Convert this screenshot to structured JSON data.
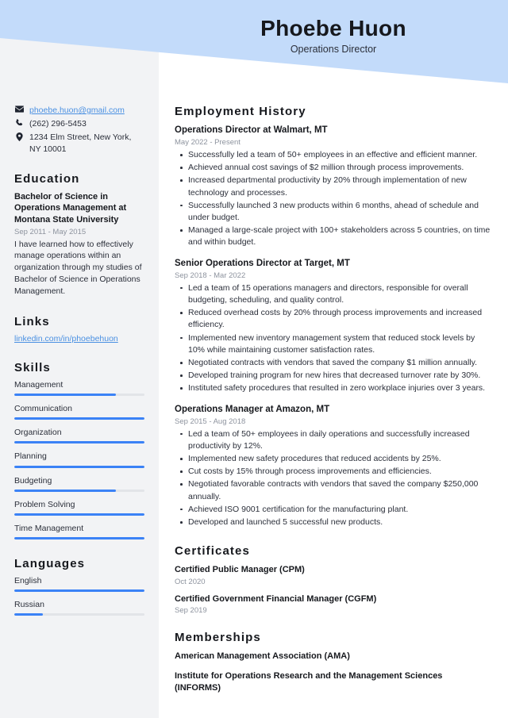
{
  "theme": {
    "header_blue": "#c3dbfa",
    "sidebar_gray": "#f2f3f5",
    "accent_blue": "#3b82f6",
    "link_blue": "#4a90e2",
    "text_dark": "#16181d",
    "text_muted": "#8d939e",
    "page_white": "#ffffff"
  },
  "header": {
    "name": "Phoebe Huon",
    "title": "Operations Director"
  },
  "sidebar": {
    "contact": [
      {
        "icon": "envelope-icon",
        "value": "phoebe.huon@gmail.com",
        "is_link": true
      },
      {
        "icon": "phone-icon",
        "value": "(262) 296-5453",
        "is_link": false
      },
      {
        "icon": "location-pin-icon",
        "value": "1234 Elm Street, New York, NY 10001",
        "is_link": false
      }
    ],
    "education": {
      "heading": "Education",
      "degree": "Bachelor of Science in Operations Management at Montana State University",
      "date": "Sep 2011 - May 2015",
      "description": "I have learned how to effectively manage operations within an organization through my studies of Bachelor of Science in Operations Management."
    },
    "links": {
      "heading": "Links",
      "items": [
        {
          "label": "linkedin.com/in/phoebehuon"
        }
      ]
    },
    "skills": {
      "heading": "Skills",
      "items": [
        {
          "label": "Management",
          "level": 78
        },
        {
          "label": "Communication",
          "level": 100
        },
        {
          "label": "Organization",
          "level": 100
        },
        {
          "label": "Planning",
          "level": 100
        },
        {
          "label": "Budgeting",
          "level": 78
        },
        {
          "label": "Problem Solving",
          "level": 100
        },
        {
          "label": "Time Management",
          "level": 100
        }
      ]
    },
    "languages": {
      "heading": "Languages",
      "items": [
        {
          "label": "English",
          "level": 100
        },
        {
          "label": "Russian",
          "level": 22
        }
      ]
    }
  },
  "main": {
    "employment": {
      "heading": "Employment History",
      "jobs": [
        {
          "role": "Operations Director at Walmart, MT",
          "date": "May 2022 - Present",
          "bullets": [
            "Successfully led a team of 50+ employees in an effective and efficient manner.",
            "Achieved annual cost savings of $2 million through process improvements.",
            "Increased departmental productivity by 20% through implementation of new technology and processes.",
            "Successfully launched 3 new products within 6 months, ahead of schedule and under budget.",
            "Managed a large-scale project with 100+ stakeholders across 5 countries, on time and within budget."
          ]
        },
        {
          "role": "Senior Operations Director at Target, MT",
          "date": "Sep 2018 - Mar 2022",
          "bullets": [
            "Led a team of 15 operations managers and directors, responsible for overall budgeting, scheduling, and quality control.",
            "Reduced overhead costs by 20% through process improvements and increased efficiency.",
            "Implemented new inventory management system that reduced stock levels by 10% while maintaining customer satisfaction rates.",
            "Negotiated contracts with vendors that saved the company $1 million annually.",
            "Developed training program for new hires that decreased turnover rate by 30%.",
            "Instituted safety procedures that resulted in zero workplace injuries over 3 years."
          ]
        },
        {
          "role": "Operations Manager at Amazon, MT",
          "date": "Sep 2015 - Aug 2018",
          "bullets": [
            "Led a team of 50+ employees in daily operations and successfully increased productivity by 12%.",
            "Implemented new safety procedures that reduced accidents by 25%.",
            "Cut costs by 15% through process improvements and efficiencies.",
            "Negotiated favorable contracts with vendors that saved the company $250,000 annually.",
            "Achieved ISO 9001 certification for the manufacturing plant.",
            "Developed and launched 5 successful new products."
          ]
        }
      ]
    },
    "certificates": {
      "heading": "Certificates",
      "items": [
        {
          "name": "Certified Public Manager (CPM)",
          "date": "Oct 2020"
        },
        {
          "name": "Certified Government Financial Manager (CGFM)",
          "date": "Sep 2019"
        }
      ]
    },
    "memberships": {
      "heading": "Memberships",
      "items": [
        {
          "name": "American Management Association (AMA)"
        },
        {
          "name": "Institute for Operations Research and the Management Sciences (INFORMS)"
        }
      ]
    }
  }
}
